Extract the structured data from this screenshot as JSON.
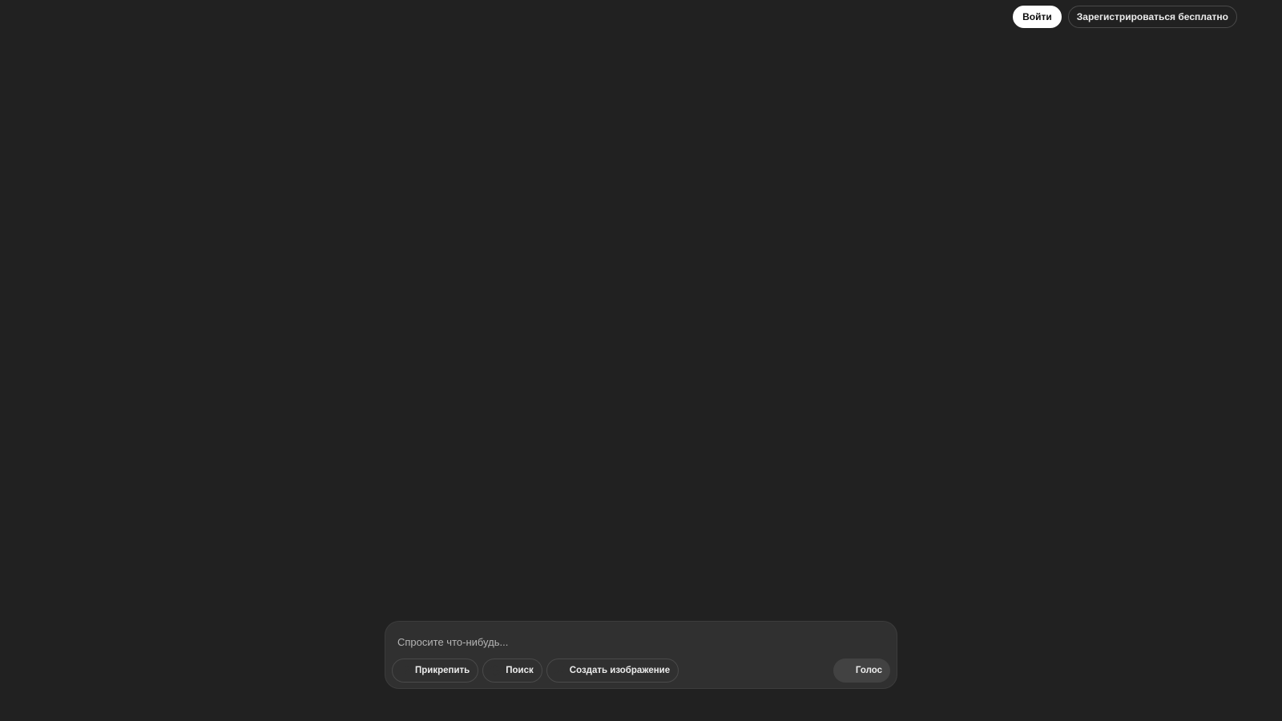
{
  "header": {
    "login_label": "Войти",
    "signup_label": "Зарегистрироваться бесплатно"
  },
  "composer": {
    "placeholder": "Спросите что-нибудь...",
    "tools": {
      "attach_label": "Прикрепить",
      "attach_icon": "paperclip-icon",
      "search_label": "Поиск",
      "search_icon": "globe-icon",
      "image_label": "Создать изображение",
      "image_icon": "image-icon"
    },
    "voice_label": "Голос",
    "voice_icon": "voice-waveform-icon"
  },
  "colors": {
    "background": "#212121",
    "composer_bg": "#303030",
    "text": "#ececec",
    "login_bg": "#ffffff"
  }
}
